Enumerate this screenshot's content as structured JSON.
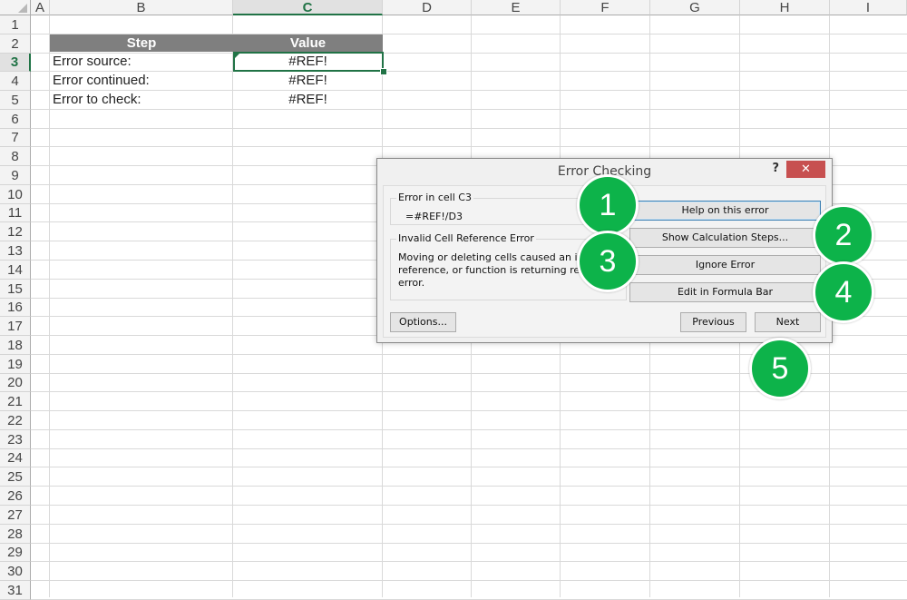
{
  "columns": [
    "A",
    "B",
    "C",
    "D",
    "E",
    "F",
    "G",
    "H",
    "I"
  ],
  "selected_column": "C",
  "rows": [
    "1",
    "2",
    "3",
    "4",
    "5",
    "6",
    "7",
    "8",
    "9",
    "10",
    "11",
    "12",
    "13",
    "14",
    "15",
    "16",
    "17",
    "18",
    "19",
    "20",
    "21",
    "22",
    "23",
    "24",
    "25",
    "26",
    "27",
    "28",
    "29",
    "30",
    "31"
  ],
  "selected_row": "3",
  "table": {
    "header": {
      "step": "Step",
      "value": "Value"
    },
    "rows": [
      {
        "step": "Error source:",
        "value": "#REF!"
      },
      {
        "step": "Error continued:",
        "value": "#REF!"
      },
      {
        "step": "Error to check:",
        "value": "#REF!"
      }
    ]
  },
  "dialog": {
    "title": "Error Checking",
    "help": "?",
    "close": "✕",
    "error_group_label": "Error in cell C3",
    "formula": "=#REF!/D3",
    "desc_group_label": "Invalid Cell Reference Error",
    "desc_lines": [
      "Moving or deleting cells caused an invalid cell",
      "reference, or function is returning reference",
      "error."
    ],
    "buttons": {
      "help": "Help on this error",
      "calc_steps": "Show Calculation Steps...",
      "ignore": "Ignore Error",
      "edit": "Edit in Formula Bar",
      "options": "Options...",
      "previous": "Previous",
      "next": "Next"
    }
  },
  "badges": [
    "1",
    "2",
    "3",
    "4",
    "5"
  ],
  "colors": {
    "accent": "#217346",
    "badge": "#0db34a",
    "header_fill": "#7f7f7f",
    "close": "#c75050"
  }
}
